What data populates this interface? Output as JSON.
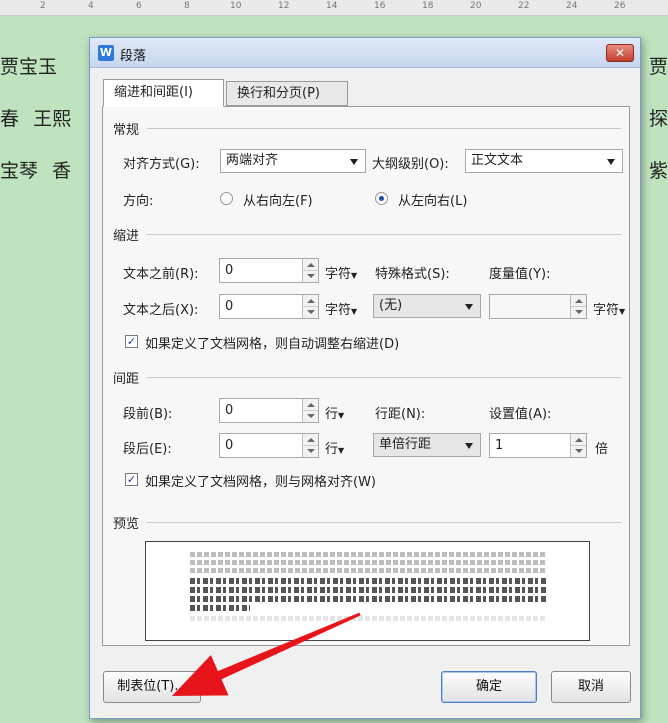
{
  "background": {
    "ruler_numbers": [
      "2",
      "4",
      "6",
      "8",
      "10",
      "12",
      "14",
      "16",
      "18",
      "20",
      "22",
      "24",
      "26"
    ],
    "lines": [
      {
        "left": "贾宝玉",
        "left_extra": "",
        "right": "贾"
      },
      {
        "left": "春",
        "left_extra": "王熙",
        "right": "探"
      },
      {
        "left": "宝琴",
        "left_extra": "香",
        "right": "紫"
      }
    ]
  },
  "dialog": {
    "title": "段落",
    "app_icon_letter": "W",
    "close_glyph": "✕",
    "tabs": [
      {
        "label": "缩进和间距(I)",
        "active": true
      },
      {
        "label": "换行和分页(P)",
        "active": false
      }
    ],
    "general": {
      "section": "常规",
      "align_label": "对齐方式(G):",
      "align_value": "两端对齐",
      "outline_label": "大纲级别(O):",
      "outline_value": "正文文本",
      "direction_label": "方向:",
      "rtl_label": "从右向左(F)",
      "ltr_label": "从左向右(L)",
      "direction_selected": "ltr"
    },
    "indent": {
      "section": "缩进",
      "before_label": "文本之前(R):",
      "before_value": "0",
      "before_unit": "字符",
      "after_label": "文本之后(X):",
      "after_value": "0",
      "after_unit": "字符",
      "special_label": "特殊格式(S):",
      "special_value": "(无)",
      "measure_label": "度量值(Y):",
      "measure_value": "",
      "measure_unit": "字符",
      "auto_adjust_checked": true,
      "auto_adjust_label": "如果定义了文档网格，则自动调整右缩进(D)"
    },
    "spacing": {
      "section": "间距",
      "before_label": "段前(B):",
      "before_value": "0",
      "before_unit": "行",
      "after_label": "段后(E):",
      "after_value": "0",
      "after_unit": "行",
      "line_label": "行距(N):",
      "line_value": "单倍行距",
      "setting_label": "设置值(A):",
      "setting_value": "1",
      "setting_unit": "倍",
      "snap_grid_checked": true,
      "snap_grid_label": "如果定义了文档网格，则与网格对齐(W)"
    },
    "preview": {
      "section": "预览"
    },
    "buttons": {
      "tabs": "制表位(T)...",
      "ok": "确定",
      "cancel": "取消"
    }
  },
  "annotation": {
    "arrow_color": "#e8141b"
  }
}
